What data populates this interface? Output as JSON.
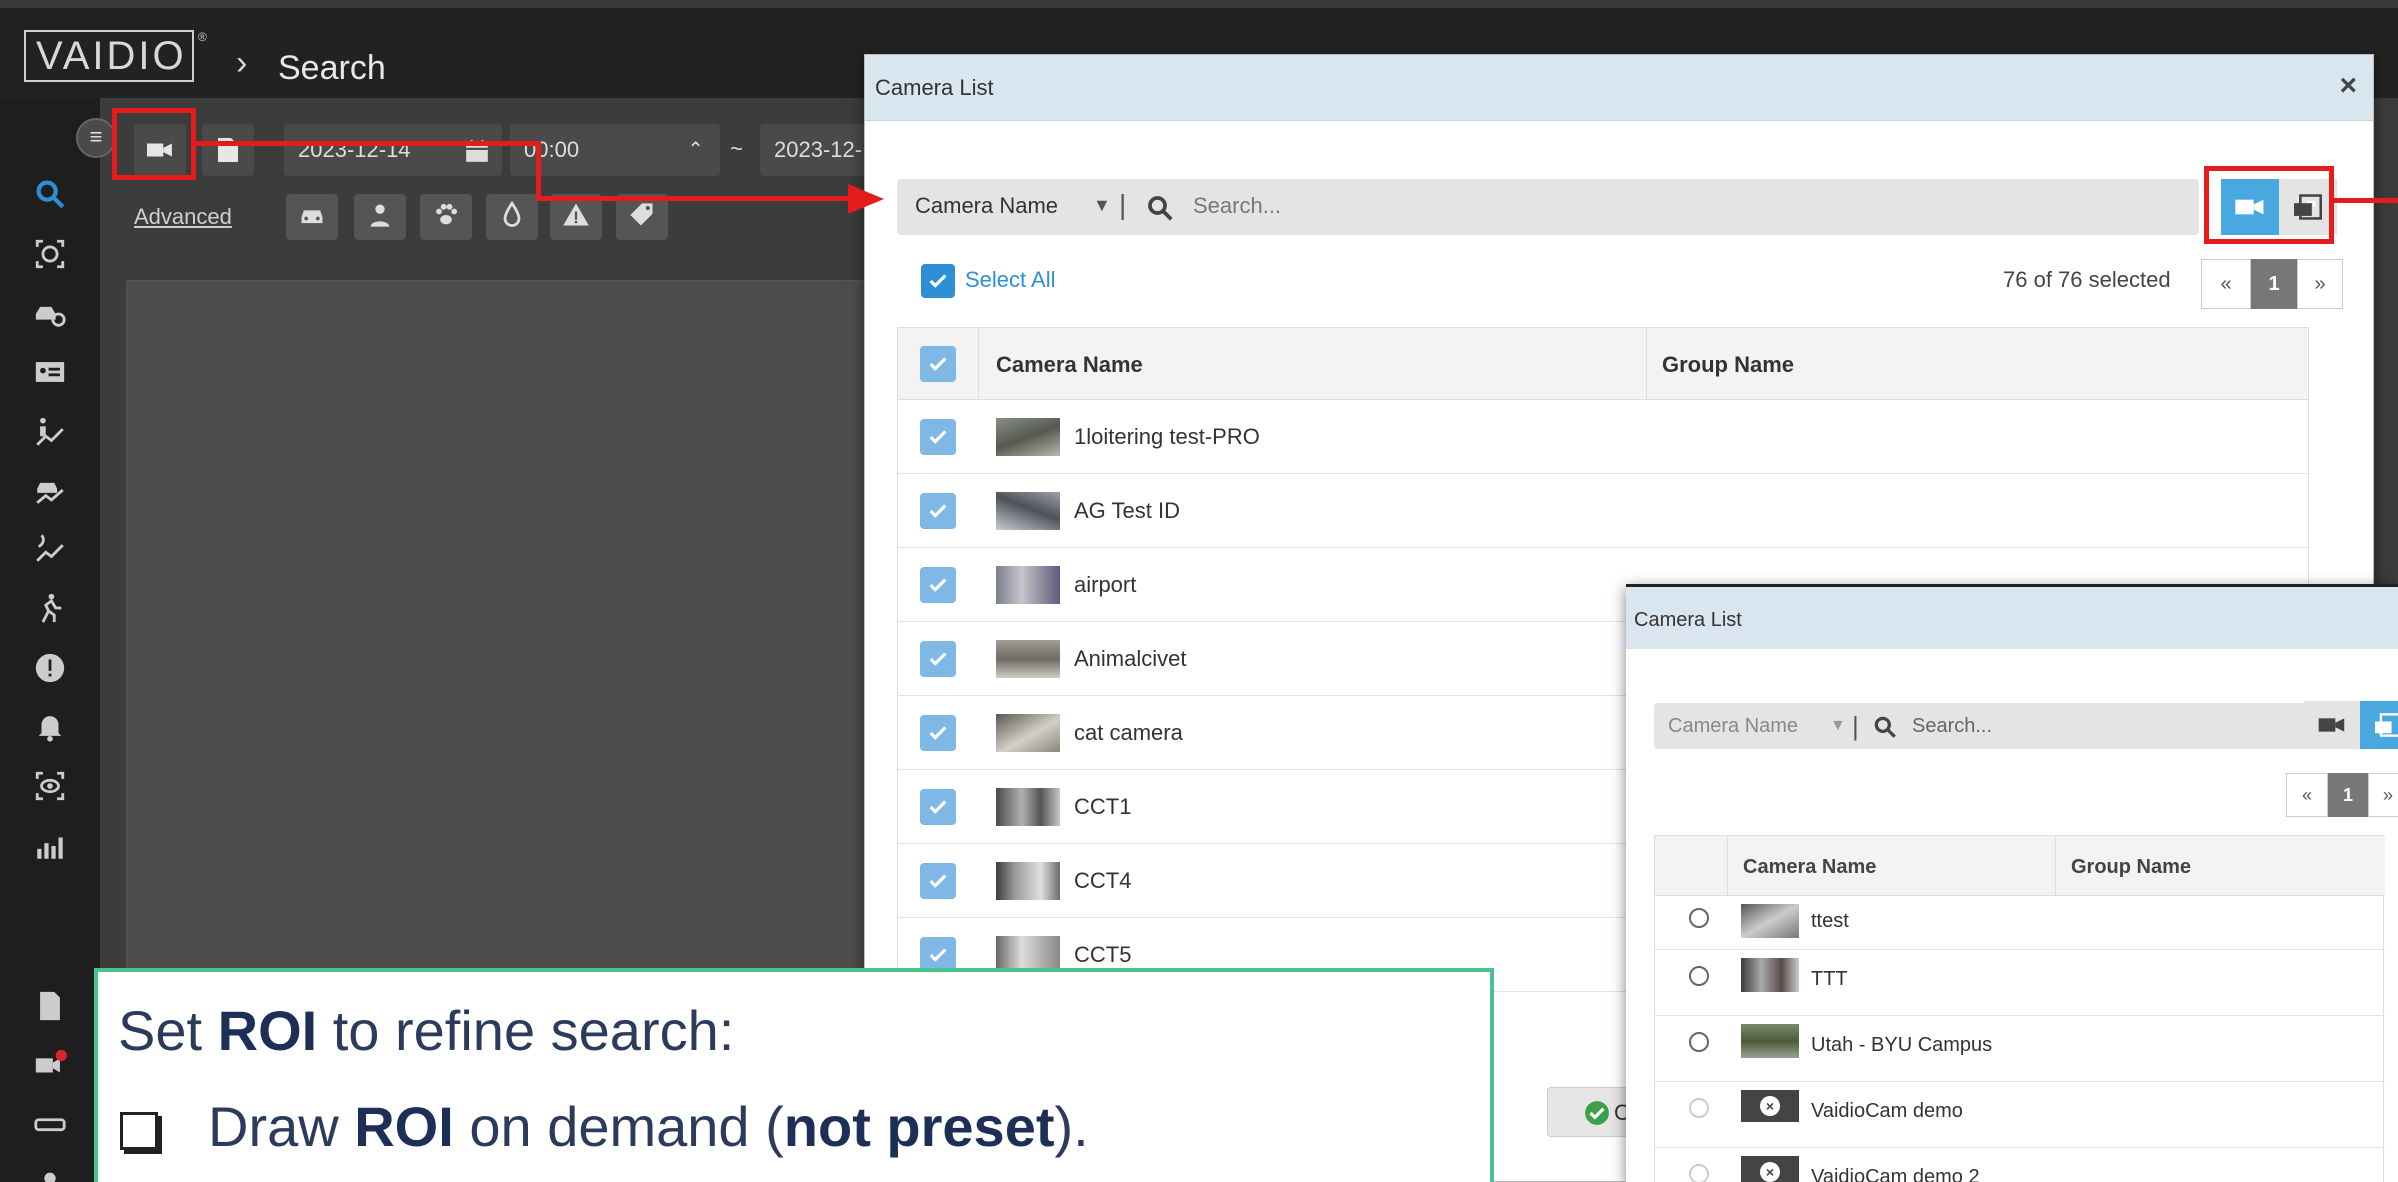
{
  "app": {
    "logo": "VAIDIO",
    "logo_reg": "®",
    "breadcrumb_sep": "›",
    "page_title": "Search"
  },
  "toolbar": {
    "start_date": "2023-12-14",
    "start_time": "00:00",
    "range_sep": "~",
    "end_date": "2023-12-",
    "advanced_label": "Advanced"
  },
  "camera_list": {
    "title": "Camera List",
    "close": "×",
    "search_field": "Camera Name",
    "search_caret": "▼",
    "search_pipe": "|",
    "search_placeholder": "Search...",
    "select_all_label": "Select All",
    "selected_count": "76 of 76 selected",
    "pager": {
      "prev": "«",
      "page": "1",
      "next": "»"
    },
    "columns": {
      "name": "Camera Name",
      "group": "Group Name"
    },
    "rows": [
      {
        "name": "1loitering test-PRO"
      },
      {
        "name": "AG Test ID"
      },
      {
        "name": "airport"
      },
      {
        "name": "Animalcivet"
      },
      {
        "name": "cat camera"
      },
      {
        "name": "CCT1"
      },
      {
        "name": "CCT4"
      },
      {
        "name": "CCT5"
      }
    ],
    "ok_label": "C"
  },
  "camera_list_2": {
    "title": "Camera List",
    "search_field": "Camera Name",
    "search_caret": "▼",
    "search_pipe": "|",
    "search_placeholder": "Search...",
    "pager": {
      "prev": "«",
      "page": "1",
      "next": "»"
    },
    "columns": {
      "name": "Camera Name",
      "group": "Group Name"
    },
    "rows": [
      {
        "name": "ttest"
      },
      {
        "name": "TTT"
      },
      {
        "name": "Utah - BYU Campus"
      },
      {
        "name": "VaidioCam demo"
      },
      {
        "name": "VaidioCam demo 2"
      }
    ]
  },
  "callout": {
    "line1_pre": "Set ",
    "line1_bold": "ROI",
    "line1_post": " to refine search:",
    "line2_pre": "Draw ",
    "line2_bold1": "ROI",
    "line2_mid": " on demand (",
    "line2_bold2": "not preset",
    "line2_post": ")."
  },
  "colors": {
    "accent": "#2f8fd6",
    "highlight": "#e51c1c",
    "callout_border": "#46c48a",
    "alert": "#d9232d"
  }
}
